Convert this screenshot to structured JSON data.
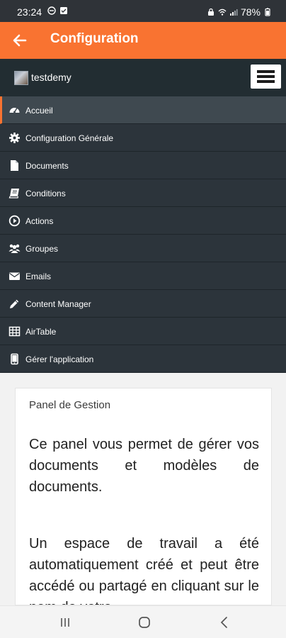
{
  "status_bar": {
    "time": "23:24",
    "battery": "78%",
    "icons": [
      "do-not-disturb-icon",
      "notification-icon",
      "lock-icon",
      "wifi-icon",
      "signal-icon",
      "battery-icon"
    ]
  },
  "app_bar": {
    "title": "Configuration",
    "accent_color": "#f97331"
  },
  "sidebar": {
    "username": "testdemy",
    "items": [
      {
        "label": "Accueil",
        "icon": "dashboard-icon",
        "active": true
      },
      {
        "label": "Configuration Générale",
        "icon": "gear-icon"
      },
      {
        "label": "Documents",
        "icon": "document-icon"
      },
      {
        "label": "Conditions",
        "icon": "book-icon"
      },
      {
        "label": "Actions",
        "icon": "play-circle-icon"
      },
      {
        "label": "Groupes",
        "icon": "users-icon"
      },
      {
        "label": "Emails",
        "icon": "envelope-icon"
      },
      {
        "label": "Content Manager",
        "icon": "pencil-icon"
      },
      {
        "label": "AirTable",
        "icon": "table-icon"
      },
      {
        "label": "Gérer l'application",
        "icon": "mobile-icon"
      }
    ]
  },
  "panel": {
    "title": "Panel de Gestion",
    "paragraph_1": "Ce panel vous permet de gérer vos documents et modèles de documents.",
    "paragraph_2": "Un espace de travail a été automatiquement créé et peut être accédé ou partagé en cliquant sur le nom de votre"
  }
}
